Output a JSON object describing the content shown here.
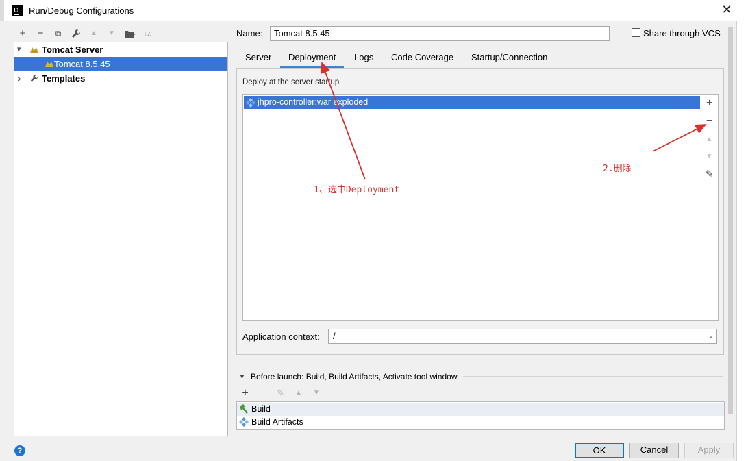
{
  "window": {
    "title": "Run/Debug Configurations",
    "app_icon_text": "IJ",
    "close_glyph": "✕"
  },
  "toolbar": {
    "add": "+",
    "remove": "−",
    "copy": "⧉",
    "edit": "🔧",
    "up": "▲",
    "down": "▼",
    "folder": "📁",
    "sort": "↓z"
  },
  "tree": {
    "group_label": "Tomcat Server",
    "config_label": "Tomcat 8.5.45",
    "templates_label": "Templates",
    "expanded_caret": "▾",
    "collapsed_caret": "›"
  },
  "config": {
    "name_label": "Name:",
    "name_value": "Tomcat 8.5.45",
    "share_label": "Share through VCS",
    "share_checked": false
  },
  "tabs": [
    {
      "label": "Server",
      "active": false
    },
    {
      "label": "Deployment",
      "active": true
    },
    {
      "label": "Logs",
      "active": false
    },
    {
      "label": "Code Coverage",
      "active": false
    },
    {
      "label": "Startup/Connection",
      "active": false
    }
  ],
  "deployment": {
    "section_title": "Deploy at the server startup",
    "items": [
      "jhpro-controller:war exploded"
    ],
    "side_add": "+",
    "side_remove": "−",
    "side_up": "▲",
    "side_down": "▼",
    "side_edit": "✎",
    "context_label": "Application context:",
    "context_value": "/",
    "context_dropdown": "⌄"
  },
  "before_launch": {
    "caret": "▼",
    "label": "Before launch: Build, Build Artifacts, Activate tool window",
    "add": "+",
    "remove": "−",
    "edit": "✎",
    "up": "▲",
    "down": "▼",
    "items": [
      "Build",
      "Build Artifacts"
    ]
  },
  "buttons": {
    "help": "?",
    "ok": "OK",
    "cancel": "Cancel",
    "apply": "Apply"
  },
  "annotations": {
    "step1": "1、选中Deployment",
    "step2": "2.删除",
    "color": "#d9312c"
  },
  "colors": {
    "selection": "#3875d6",
    "tab_underline": "#4083c9",
    "ok_border": "#0078d7"
  }
}
